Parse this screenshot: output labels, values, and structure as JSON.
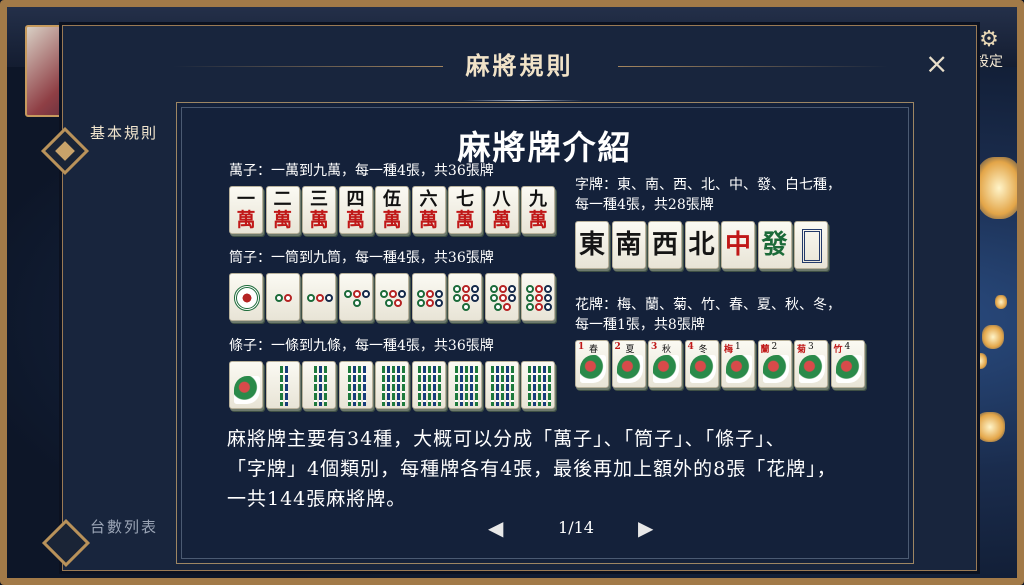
{
  "modal": {
    "title": "麻將規則",
    "close": "×"
  },
  "settings": {
    "label": "設定",
    "icon": "gear-icon"
  },
  "sidebar": {
    "items": [
      {
        "label": "基本規則",
        "active": true
      },
      {
        "label": "台數列表",
        "active": false
      }
    ]
  },
  "content": {
    "page_title": "麻將牌介紹",
    "man": {
      "caption": "萬子：一萬到九萬，每一種4張，共36張牌",
      "tiles": [
        "一",
        "二",
        "三",
        "四",
        "伍",
        "六",
        "七",
        "八",
        "九"
      ],
      "suit_char": "萬"
    },
    "pin": {
      "caption": "筒子：一筒到九筒，每一種4張，共36張牌"
    },
    "sou": {
      "caption": "條子：一條到九條，每一種4張，共36張牌"
    },
    "honor": {
      "caption_line1": "字牌：東、南、西、北、中、發、白七種，",
      "caption_line2": "每一種4張，共28張牌",
      "tiles": [
        "東",
        "南",
        "西",
        "北",
        "中",
        "發"
      ]
    },
    "flower": {
      "caption_line1": "花牌：梅、蘭、菊、竹、春、夏、秋、冬，",
      "caption_line2": "每一種1張，共8張牌",
      "tiles": [
        [
          "1",
          "春"
        ],
        [
          "2",
          "夏"
        ],
        [
          "3",
          "秋"
        ],
        [
          "4",
          "冬"
        ],
        [
          "梅",
          "1"
        ],
        [
          "蘭",
          "2"
        ],
        [
          "菊",
          "3"
        ],
        [
          "竹",
          "4"
        ]
      ]
    },
    "description": {
      "line1": "麻將牌主要有34種，大概可以分成「萬子」、「筒子」、「條子」、",
      "line2": "「字牌」4個類別，每種牌各有4張，最後再加上額外的8張「花牌」，",
      "line3": "一共144張麻將牌。"
    }
  },
  "pager": {
    "current": "1/14",
    "prev_icon": "◀",
    "next_icon": "▶"
  },
  "colors": {
    "accent": "#a27a48",
    "panel": "#14213a",
    "red": "#c01818",
    "green": "#1c6b3a"
  }
}
